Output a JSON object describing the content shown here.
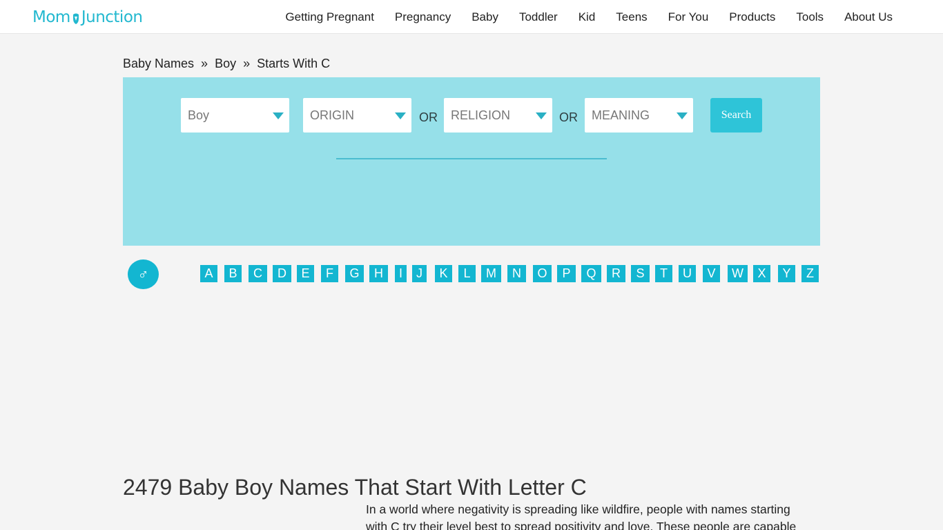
{
  "header": {
    "logo_left": "Mom",
    "logo_right": "Junction",
    "nav": [
      "Getting Pregnant",
      "Pregnancy",
      "Baby",
      "Toddler",
      "Kid",
      "Teens",
      "For You",
      "Products",
      "Tools",
      "About Us"
    ]
  },
  "breadcrumb": {
    "items": [
      "Baby Names",
      "Boy",
      "Starts With C"
    ],
    "separator": "»"
  },
  "search": {
    "gender_value": "Boy",
    "origin_value": "ORIGIN",
    "religion_value": "RELIGION",
    "meaning_value": "MEANING",
    "or_label": "OR",
    "button_label": "Search"
  },
  "alphabet": {
    "gender_icon": "male-symbol-icon",
    "gender_glyph": "♂",
    "letters": [
      "A",
      "B",
      "C",
      "D",
      "E",
      "F",
      "G",
      "H",
      "I",
      "J",
      "K",
      "L",
      "M",
      "N",
      "O",
      "P",
      "Q",
      "R",
      "S",
      "T",
      "U",
      "V",
      "W",
      "X",
      "Y",
      "Z"
    ]
  },
  "main": {
    "title": "2479 Baby Boy Names That Start With Letter C",
    "intro": "In a world where negativity is spreading like wildfire, people with names starting with C try their level best to spread positivity and love. These people are capable"
  },
  "colors": {
    "brand": "#22b8cf",
    "panel": "#96e0e9",
    "letter_bg": "#13b6d1",
    "search_button": "#2ec4d8"
  }
}
